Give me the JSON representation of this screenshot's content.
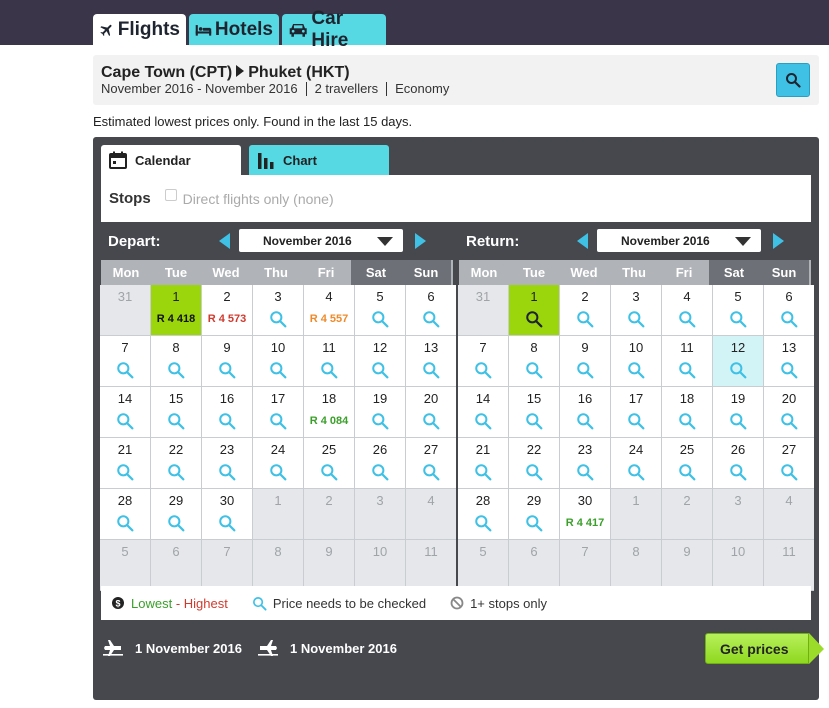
{
  "tabs": [
    {
      "label": "Flights",
      "icon": "plane-icon",
      "active": true
    },
    {
      "label": "Hotels",
      "icon": "bed-icon",
      "active": false
    },
    {
      "label": "Car Hire",
      "icon": "car-icon",
      "active": false
    }
  ],
  "search": {
    "origin": "Cape Town (CPT)",
    "destination": "Phuket (HKT)",
    "dates": "November 2016 - November 2016",
    "travellers": "2 travellers",
    "cabin": "Economy"
  },
  "notice": "Estimated lowest prices only. Found in the last 15 days.",
  "view_tabs": [
    {
      "label": "Calendar",
      "icon": "calendar-icon",
      "active": true
    },
    {
      "label": "Chart",
      "icon": "bar-chart-icon",
      "active": false
    }
  ],
  "stops": {
    "label": "Stops",
    "option": "Direct flights only (none)",
    "checked": false
  },
  "weekdays": [
    "Mon",
    "Tue",
    "Wed",
    "Thu",
    "Fri",
    "Sat",
    "Sun"
  ],
  "depart": {
    "title": "Depart:",
    "month": "November 2016",
    "cells": [
      {
        "d": "31",
        "out": true
      },
      {
        "d": "1",
        "price": "R 4 418",
        "pc": "dark",
        "sel": true
      },
      {
        "d": "2",
        "price": "R 4 573",
        "pc": "red"
      },
      {
        "d": "3",
        "mag": true
      },
      {
        "d": "4",
        "price": "R 4 557",
        "pc": "orange"
      },
      {
        "d": "5",
        "mag": true
      },
      {
        "d": "6",
        "mag": true
      },
      {
        "d": "7",
        "mag": true
      },
      {
        "d": "8",
        "mag": true
      },
      {
        "d": "9",
        "mag": true
      },
      {
        "d": "10",
        "mag": true
      },
      {
        "d": "11",
        "mag": true
      },
      {
        "d": "12",
        "mag": true
      },
      {
        "d": "13",
        "mag": true
      },
      {
        "d": "14",
        "mag": true
      },
      {
        "d": "15",
        "mag": true
      },
      {
        "d": "16",
        "mag": true
      },
      {
        "d": "17",
        "mag": true
      },
      {
        "d": "18",
        "price": "R 4 084",
        "pc": "green"
      },
      {
        "d": "19",
        "mag": true
      },
      {
        "d": "20",
        "mag": true
      },
      {
        "d": "21",
        "mag": true
      },
      {
        "d": "22",
        "mag": true
      },
      {
        "d": "23",
        "mag": true
      },
      {
        "d": "24",
        "mag": true
      },
      {
        "d": "25",
        "mag": true
      },
      {
        "d": "26",
        "mag": true
      },
      {
        "d": "27",
        "mag": true
      },
      {
        "d": "28",
        "mag": true
      },
      {
        "d": "29",
        "mag": true
      },
      {
        "d": "30",
        "mag": true
      },
      {
        "d": "1",
        "out": true
      },
      {
        "d": "2",
        "out": true
      },
      {
        "d": "3",
        "out": true
      },
      {
        "d": "4",
        "out": true
      },
      {
        "d": "5",
        "out": true
      },
      {
        "d": "6",
        "out": true
      },
      {
        "d": "7",
        "out": true
      },
      {
        "d": "8",
        "out": true
      },
      {
        "d": "9",
        "out": true
      },
      {
        "d": "10",
        "out": true
      },
      {
        "d": "11",
        "out": true
      }
    ]
  },
  "return": {
    "title": "Return:",
    "month": "November 2016",
    "cells": [
      {
        "d": "31",
        "out": true
      },
      {
        "d": "1",
        "mag": true,
        "sel": true
      },
      {
        "d": "2",
        "mag": true
      },
      {
        "d": "3",
        "mag": true
      },
      {
        "d": "4",
        "mag": true
      },
      {
        "d": "5",
        "mag": true
      },
      {
        "d": "6",
        "mag": true
      },
      {
        "d": "7",
        "mag": true
      },
      {
        "d": "8",
        "mag": true
      },
      {
        "d": "9",
        "mag": true
      },
      {
        "d": "10",
        "mag": true
      },
      {
        "d": "11",
        "mag": true
      },
      {
        "d": "12",
        "mag": true,
        "hl": true
      },
      {
        "d": "13",
        "mag": true
      },
      {
        "d": "14",
        "mag": true
      },
      {
        "d": "15",
        "mag": true
      },
      {
        "d": "16",
        "mag": true
      },
      {
        "d": "17",
        "mag": true
      },
      {
        "d": "18",
        "mag": true
      },
      {
        "d": "19",
        "mag": true
      },
      {
        "d": "20",
        "mag": true
      },
      {
        "d": "21",
        "mag": true
      },
      {
        "d": "22",
        "mag": true
      },
      {
        "d": "23",
        "mag": true
      },
      {
        "d": "24",
        "mag": true
      },
      {
        "d": "25",
        "mag": true
      },
      {
        "d": "26",
        "mag": true
      },
      {
        "d": "27",
        "mag": true
      },
      {
        "d": "28",
        "mag": true
      },
      {
        "d": "29",
        "mag": true
      },
      {
        "d": "30",
        "price": "R 4 417",
        "pc": "green"
      },
      {
        "d": "1",
        "out": true
      },
      {
        "d": "2",
        "out": true
      },
      {
        "d": "3",
        "out": true
      },
      {
        "d": "4",
        "out": true
      },
      {
        "d": "5",
        "out": true
      },
      {
        "d": "6",
        "out": true
      },
      {
        "d": "7",
        "out": true
      },
      {
        "d": "8",
        "out": true
      },
      {
        "d": "9",
        "out": true
      },
      {
        "d": "10",
        "out": true
      },
      {
        "d": "11",
        "out": true
      }
    ]
  },
  "legend": {
    "lowest": "Lowest",
    "sep": " - ",
    "highest": "Highest",
    "check": "Price needs to be checked",
    "stops": "1+ stops only"
  },
  "footer": {
    "depart_date": "1 November 2016",
    "return_date": "1 November 2016",
    "cta": "Get prices"
  },
  "colors": {
    "accent": "#57d9e3",
    "selected": "#9bd60d",
    "panel": "#46484e",
    "lowest": "#3aa02a",
    "highest": "#d03a2e"
  }
}
